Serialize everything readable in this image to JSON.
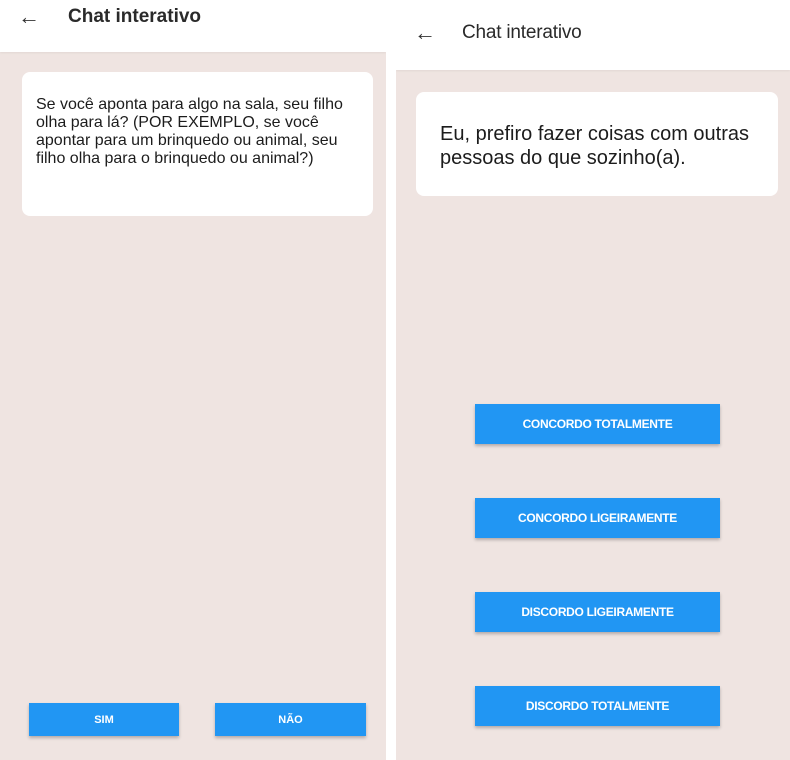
{
  "colors": {
    "background": "#efe4e1",
    "appbar": "#ffffff",
    "button": "#2196f3",
    "button_text": "#ffffff"
  },
  "left": {
    "header": {
      "back_icon": "arrow-left-icon",
      "back_glyph": "←",
      "title": "Chat interativo"
    },
    "message": "Se você aponta para algo na sala, seu filho olha para lá? (POR EXEMPLO, se você apontar para um brinquedo ou animal, seu filho olha para o brinquedo ou animal?)",
    "buttons": {
      "sim": "SIM",
      "nao": "NÃO"
    }
  },
  "right": {
    "header": {
      "back_icon": "arrow-left-icon",
      "back_glyph": "←",
      "title": "Chat interativo"
    },
    "message": "Eu, prefiro fazer coisas com outras pessoas do que sozinho(a).",
    "buttons": [
      "CONCORDO TOTALMENTE",
      "CONCORDO LIGEIRAMENTE",
      "DISCORDO LIGEIRAMENTE",
      "DISCORDO TOTALMENTE"
    ]
  }
}
